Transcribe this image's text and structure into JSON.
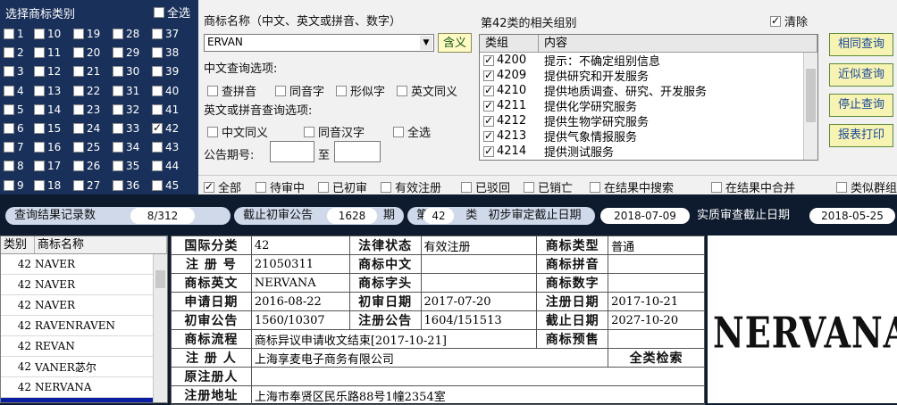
{
  "class_panel": {
    "title": "选择商标类别",
    "select_all": "全选",
    "classes": [
      [
        "1",
        "10",
        "19",
        "28",
        "37"
      ],
      [
        "2",
        "11",
        "20",
        "29",
        "38"
      ],
      [
        "3",
        "12",
        "21",
        "30",
        "39"
      ],
      [
        "4",
        "13",
        "22",
        "31",
        "40"
      ],
      [
        "5",
        "14",
        "23",
        "32",
        "41"
      ],
      [
        "6",
        "15",
        "24",
        "33",
        "42"
      ],
      [
        "7",
        "16",
        "25",
        "34",
        "43"
      ],
      [
        "8",
        "17",
        "26",
        "35",
        "44"
      ],
      [
        "9",
        "18",
        "27",
        "36",
        "45"
      ]
    ],
    "checked": "42"
  },
  "search": {
    "name_label": "商标名称（中文、英文或拼音、数字）",
    "name_value": "ERVAN",
    "contain_button": "含义",
    "cn_options_label": "中文查询选项:",
    "cn_options": [
      "查拼音",
      "同音字",
      "形似字",
      "英文同义"
    ],
    "en_options_label": "英文或拼音查询选项:",
    "en_options": [
      "中文同义",
      "同音汉字",
      "全选"
    ],
    "period_label": "公告期号:",
    "period_to": "至"
  },
  "groups": {
    "title": "第42类的相关组别",
    "clear_label": "清除",
    "header_code": "类组",
    "header_content": "内容",
    "rows": [
      {
        "code": "4200",
        "text": "提示：不确定组别信息"
      },
      {
        "code": "4209",
        "text": "提供研究和开发服务"
      },
      {
        "code": "4210",
        "text": "提供地质调查、研究、开发服务"
      },
      {
        "code": "4211",
        "text": "提供化学研究服务"
      },
      {
        "code": "4212",
        "text": "提供生物学研究服务"
      },
      {
        "code": "4213",
        "text": "提供气象情报服务"
      },
      {
        "code": "4214",
        "text": "提供测试服务"
      }
    ]
  },
  "actions": [
    "相同查询",
    "近似查询",
    "停止查询",
    "报表打印"
  ],
  "filters": [
    "全部",
    "待审中",
    "已初审",
    "有效注册",
    "已驳回",
    "已销亡",
    "在结果中搜索",
    "在结果中合并",
    "类似群组"
  ],
  "result_bar": {
    "count_label": "查询结果记录数",
    "count_value": "8/312",
    "deadline_label": "截止初审公告",
    "deadline_value": "1628",
    "deadline_unit": "期",
    "class_prefix": "第",
    "class_value": "42",
    "class_suffix": "类",
    "prelim_label": "初步审定截止日期",
    "prelim_value": "2018-07-09",
    "exam_label": "实质审查截止日期",
    "exam_value": "2018-05-25"
  },
  "list": {
    "header_class": "类别",
    "header_name": "商标名称",
    "rows": [
      {
        "class": "42",
        "name": "NAVER"
      },
      {
        "class": "42",
        "name": "NAVER"
      },
      {
        "class": "42",
        "name": "NAVER"
      },
      {
        "class": "42",
        "name": "RAVENRAVEN"
      },
      {
        "class": "42",
        "name": "REVAN"
      },
      {
        "class": "42",
        "name": "VANER苾尔"
      },
      {
        "class": "42",
        "name": "NERVANA"
      },
      {
        "class": "",
        "name": ""
      }
    ]
  },
  "detail": {
    "intl_class_k": "国际分类",
    "intl_class_v": "42",
    "legal_k": "法律状态",
    "legal_v": "有效注册",
    "type_k": "商标类型",
    "type_v": "普通",
    "reg_no_k": "注 册 号",
    "reg_no_v": "21050311",
    "cn_k": "商标中文",
    "cn_v": "",
    "pinyin_k": "商标拼音",
    "pinyin_v": "",
    "en_k": "商标英文",
    "en_v": "NERVANA",
    "head_k": "商标字头",
    "head_v": "",
    "digit_k": "商标数字",
    "digit_v": "",
    "apply_k": "申请日期",
    "apply_v": "2016-08-22",
    "first_k": "初审日期",
    "first_v": "2017-07-20",
    "regdate_k": "注册日期",
    "regdate_v": "2017-10-21",
    "fa_k": "初审公告",
    "fa_v": "1560/10307",
    "ra_k": "注册公告",
    "ra_v": "1604/151513",
    "end_k": "截止日期",
    "end_v": "2027-10-20",
    "flow_k": "商标流程",
    "flow_v": "商标异议申请收文结束[2017-10-21]",
    "pre_k": "商标预售",
    "pre_v": "",
    "reg_person_k": "注 册 人",
    "reg_person_v": "上海享麦电子商务有限公司",
    "all_class_k": "全类检索",
    "orig_k": "原注册人",
    "orig_v": "",
    "addr_k": "注册地址",
    "addr_v": "上海市奉贤区民乐路88号1幢2354室"
  },
  "image": {
    "text": "NERVANA"
  }
}
